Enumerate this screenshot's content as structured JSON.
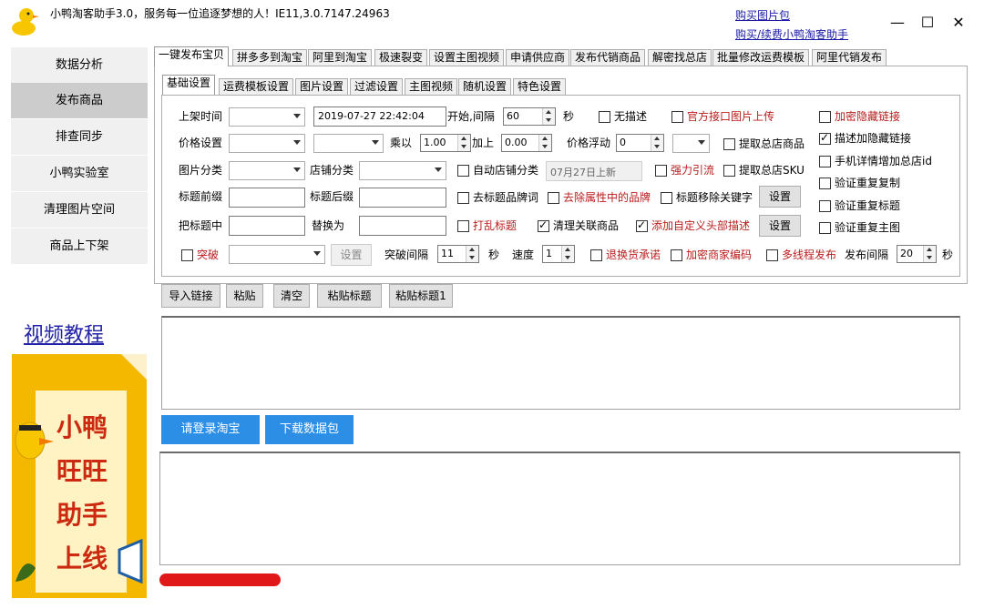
{
  "window": {
    "title": "小鸭淘客助手3.0，服务每一位追逐梦想的人！IE11,3.0.7147.24963",
    "link_buy_images": "购买图片包",
    "link_buy_renew": "购买/续费小鸭淘客助手",
    "minimize": "—",
    "maximize": "☐",
    "close": "✕"
  },
  "sidebar": {
    "items": [
      {
        "label": "数据分析"
      },
      {
        "label": "发布商品"
      },
      {
        "label": "排查同步"
      },
      {
        "label": "小鸭实验室"
      },
      {
        "label": "清理图片空间"
      },
      {
        "label": "商品上下架"
      }
    ],
    "video_link": "视频教程",
    "promo_text": "小鸭旺旺助手上线"
  },
  "main_tabs": [
    "一键发布宝贝",
    "拼多多到淘宝",
    "阿里到淘宝",
    "极速裂变",
    "设置主图视频",
    "申请供应商",
    "发布代销商品",
    "解密找总店",
    "批量修改运费模板",
    "阿里代销发布"
  ],
  "sub_tabs": [
    "基础设置",
    "运费模板设置",
    "图片设置",
    "过滤设置",
    "主图视频",
    "随机设置",
    "特色设置"
  ],
  "form": {
    "shelf_time_label": "上架时间",
    "datetime_value": "2019-07-27 22:42:04",
    "interval_label": "开始,间隔",
    "interval_value": "60",
    "seconds": "秒",
    "no_desc": "无描述",
    "official_upload": "官方接口图片上传",
    "encrypt_hidden_link": "加密隐藏链接",
    "price_setting": "价格设置",
    "multiply": "乘以",
    "multiply_value": "1.00",
    "add": "加上",
    "add_value": "0.00",
    "price_float": "价格浮动",
    "price_float_value": "0",
    "extract_main_store": "提取总店商品",
    "desc_hidden_link": "描述加隐藏链接",
    "image_category": "图片分类",
    "store_category": "店铺分类",
    "auto_store_category": "自动店铺分类",
    "auto_category_value": "07月27日上新",
    "strong_drain": "强力引流",
    "extract_sku": "提取总店SKU",
    "mobile_detail_add": "手机详情增加总店id",
    "title_prefix": "标题前缀",
    "title_suffix": "标题后缀",
    "remove_title_brand": "去标题品牌词",
    "remove_attr_brand": "去除属性中的品牌",
    "title_remove_keywords": "标题移除关键字",
    "settings_btn": "设置",
    "verify_dup_copy": "验证重复复制",
    "verify_dup_title": "验证重复标题",
    "title_contains": "把标题中",
    "replace_with": "替换为",
    "shuffle_title": "打乱标题",
    "clean_related": "清理关联商品",
    "add_custom_header": "添加自定义头部描述",
    "verify_dup_image": "验证重复主图",
    "breakthrough": "突破",
    "breakthrough_interval": "突破间隔",
    "breakthrough_interval_value": "11",
    "speed": "速度",
    "speed_value": "1",
    "return_promise": "退换货承诺",
    "encrypt_merchant_code": "加密商家编码",
    "multithread_publish": "多线程发布",
    "publish_interval": "发布间隔",
    "publish_interval_value": "20"
  },
  "actions": {
    "import_links": "导入链接",
    "paste": "粘贴",
    "clear": "清空",
    "paste_title": "粘贴标题",
    "paste_title1": "粘贴标题1",
    "login_taobao": "请登录淘宝",
    "download_pack": "下载数据包"
  },
  "colors": {
    "accent_blue": "#2d8ee6",
    "red_label": "#b81c1c",
    "link_blue": "#1a1aa6",
    "promo_yellow": "#f5b800"
  }
}
